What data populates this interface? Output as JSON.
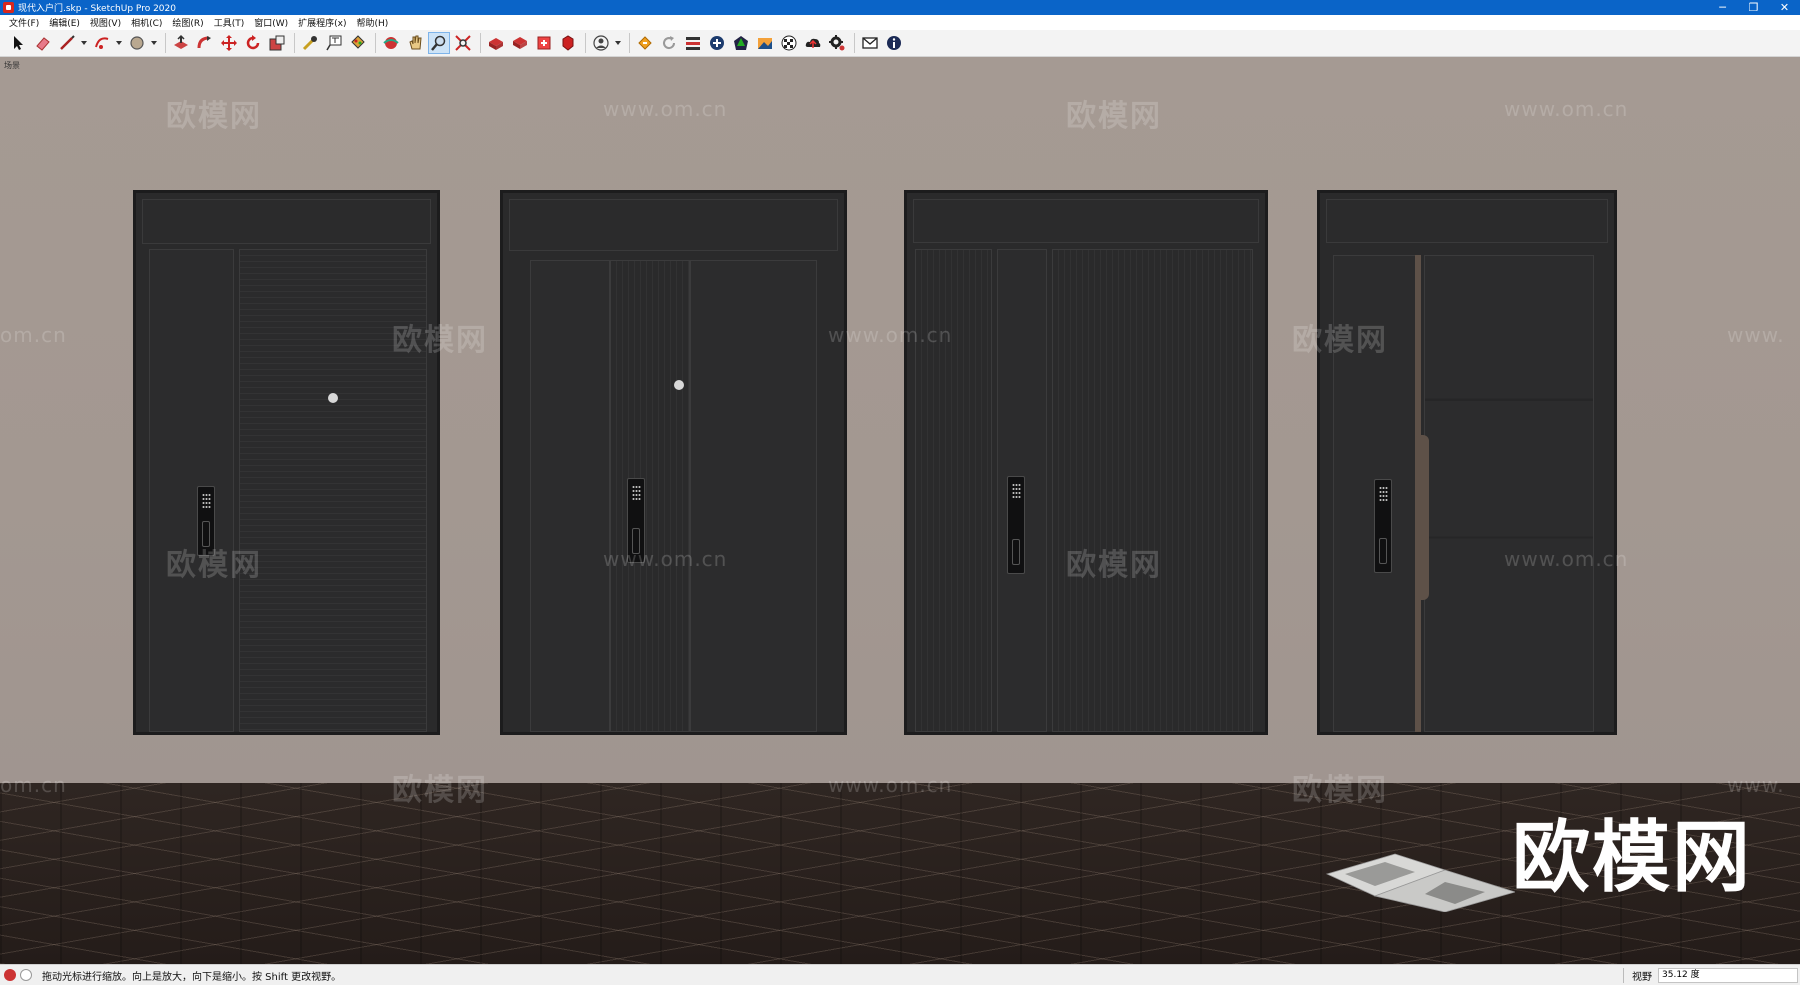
{
  "window": {
    "title": "现代入户门.skp - SketchUp Pro 2020",
    "minimize": "─",
    "restore": "❐",
    "close": "✕"
  },
  "menu": [
    "文件(F)",
    "编辑(E)",
    "视图(V)",
    "相机(C)",
    "绘图(R)",
    "工具(T)",
    "窗口(W)",
    "扩展程序(x)",
    "帮助(H)"
  ],
  "toolbar": {
    "tools": [
      "select-icon",
      "eraser-icon",
      "line-icon",
      "arc-icon",
      "shape-icon",
      "pushpull-icon",
      "followme-icon",
      "move-icon",
      "rotate-icon",
      "scale-icon",
      "tape-icon",
      "text-icon",
      "paint-icon",
      "orbit-icon",
      "pan-icon",
      "zoom-icon",
      "zoom-extents-icon",
      "warehouse-icon",
      "extension-warehouse-icon",
      "layout-icon",
      "ruby-icon",
      "account-icon",
      "extension-icons"
    ]
  },
  "viewport": {
    "scene_label": "场景",
    "watermark_cn": "欧模网",
    "watermark_url": "www.om.cn",
    "watermark_url_partial": "om.cn",
    "watermark_url_partial_right": "www.",
    "brand_logo": "欧模网"
  },
  "status": {
    "message": "拖动光标进行缩放。向上是放大，向下是缩小。按 Shift 更改视野。",
    "vcb_label": "视野",
    "vcb_value": "35.12 度"
  },
  "colors": {
    "titlebar": "#0a64c8",
    "wall": "#a39891",
    "door": "#2a2a2b",
    "floor": "#2a211d",
    "bronze_accent": "#5e5148"
  }
}
